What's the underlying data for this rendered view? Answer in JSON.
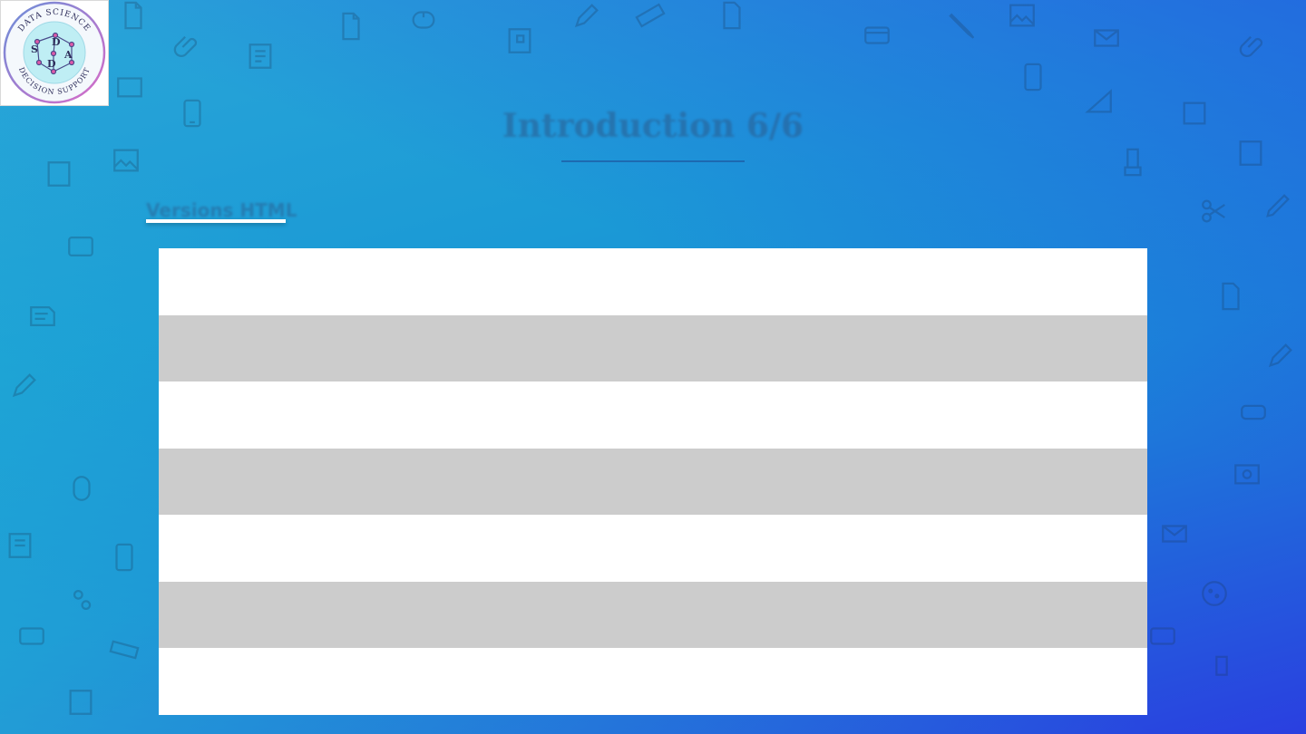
{
  "slide": {
    "title": "Introduction 6/6",
    "subtitle": "Versions HTML"
  },
  "logo": {
    "top_text": "DATA SCIENCE",
    "bottom_text": "DECISION SUPPORT",
    "letters": [
      "S",
      "D",
      "A",
      "D"
    ]
  },
  "table": {
    "rows": [
      "",
      "",
      "",
      "",
      "",
      "",
      ""
    ]
  },
  "colors": {
    "accent": "#1d5fa8",
    "row_light": "#ffffff",
    "row_dark": "#cccccc"
  }
}
